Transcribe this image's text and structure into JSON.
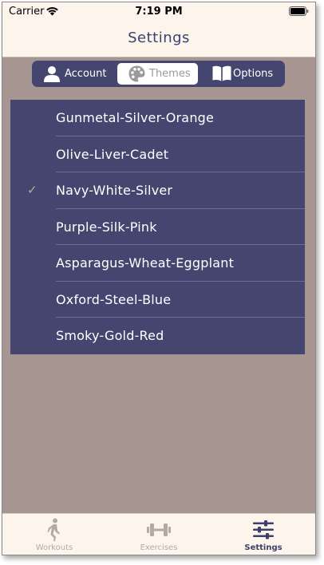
{
  "status_bar": {
    "carrier": "Carrier",
    "time": "7:19 PM"
  },
  "nav": {
    "title": "Settings"
  },
  "segments": [
    {
      "label": "Account",
      "icon": "person-icon",
      "selected": false
    },
    {
      "label": "Themes",
      "icon": "palette-icon",
      "selected": true
    },
    {
      "label": "Options",
      "icon": "book-icon",
      "selected": false
    }
  ],
  "themes": [
    {
      "label": "Gunmetal-Silver-Orange",
      "checked": false
    },
    {
      "label": "Olive-Liver-Cadet",
      "checked": false
    },
    {
      "label": "Navy-White-Silver",
      "checked": true,
      "check_glyph": "✓"
    },
    {
      "label": "Purple-Silk-Pink",
      "checked": false
    },
    {
      "label": "Asparagus-Wheat-Eggplant",
      "checked": false
    },
    {
      "label": "Oxford-Steel-Blue",
      "checked": false
    },
    {
      "label": "Smoky-Gold-Red",
      "checked": false
    }
  ],
  "tabs": [
    {
      "label": "Workouts",
      "icon": "walking-person-icon",
      "active": false
    },
    {
      "label": "Exercises",
      "icon": "dumbbell-icon",
      "active": false
    },
    {
      "label": "Settings",
      "icon": "sliders-icon",
      "active": true
    }
  ],
  "colors": {
    "background": "#a69590",
    "bar_background": "#fdf5ec",
    "accent": "#454670",
    "title": "#3d3f6e",
    "inactive_tab": "#b4aaa4"
  }
}
